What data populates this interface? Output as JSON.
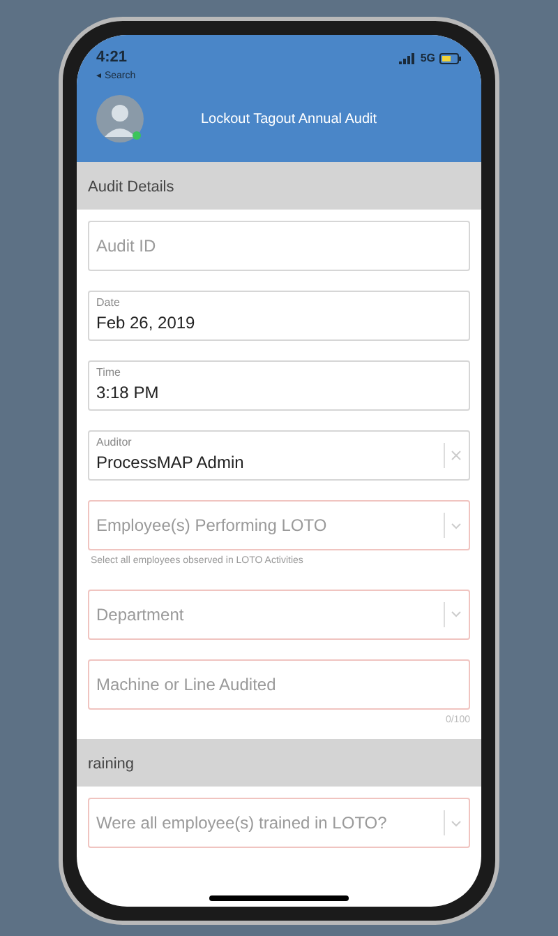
{
  "status_bar": {
    "time": "4:21",
    "back": "◂ Search",
    "network": "5G"
  },
  "header": {
    "title": "Lockout Tagout Annual Audit"
  },
  "sections": [
    {
      "title": "Audit Details",
      "fields": [
        {
          "kind": "text",
          "placeholder": "Audit ID",
          "invalid": false
        },
        {
          "kind": "value",
          "label": "Date",
          "value": "Feb 26, 2019",
          "invalid": false
        },
        {
          "kind": "value",
          "label": "Time",
          "value": "3:18 PM",
          "invalid": false
        },
        {
          "kind": "clear",
          "label": "Auditor",
          "value": "ProcessMAP Admin",
          "invalid": false
        },
        {
          "kind": "select",
          "placeholder": "Employee(s) Performing LOTO",
          "invalid": true,
          "hint": "Select all employees observed in LOTO Activities"
        },
        {
          "kind": "select",
          "placeholder": "Department",
          "invalid": true
        },
        {
          "kind": "text",
          "placeholder": "Machine or Line Audited",
          "invalid": true,
          "counter": "0/100"
        }
      ]
    },
    {
      "title": "raining",
      "fields": [
        {
          "kind": "select",
          "placeholder": "Were all employee(s) trained in LOTO?",
          "invalid": true
        }
      ]
    }
  ]
}
